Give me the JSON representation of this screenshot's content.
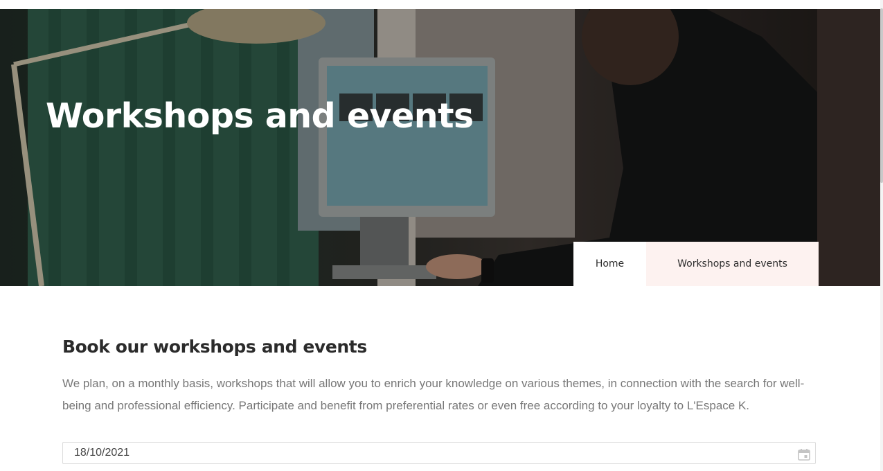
{
  "hero": {
    "title": "Workshops and events"
  },
  "breadcrumb": {
    "home_label": "Home",
    "current_label": "Workshops and events"
  },
  "section": {
    "title": "Book our workshops and events",
    "intro": "We plan, on a monthly basis, workshops that will allow you to enrich your knowledge on various themes, in connection with the search for well-being and professional efficiency. Participate and benefit from preferential rates or even free according to your loyalty to L'Espace K."
  },
  "date_picker": {
    "value": "18/10/2021",
    "icon": "calendar-icon"
  },
  "colors": {
    "breadcrumb_active_bg": "#fdf2f0",
    "heading": "#2b2b2b",
    "body_text": "#777777"
  }
}
